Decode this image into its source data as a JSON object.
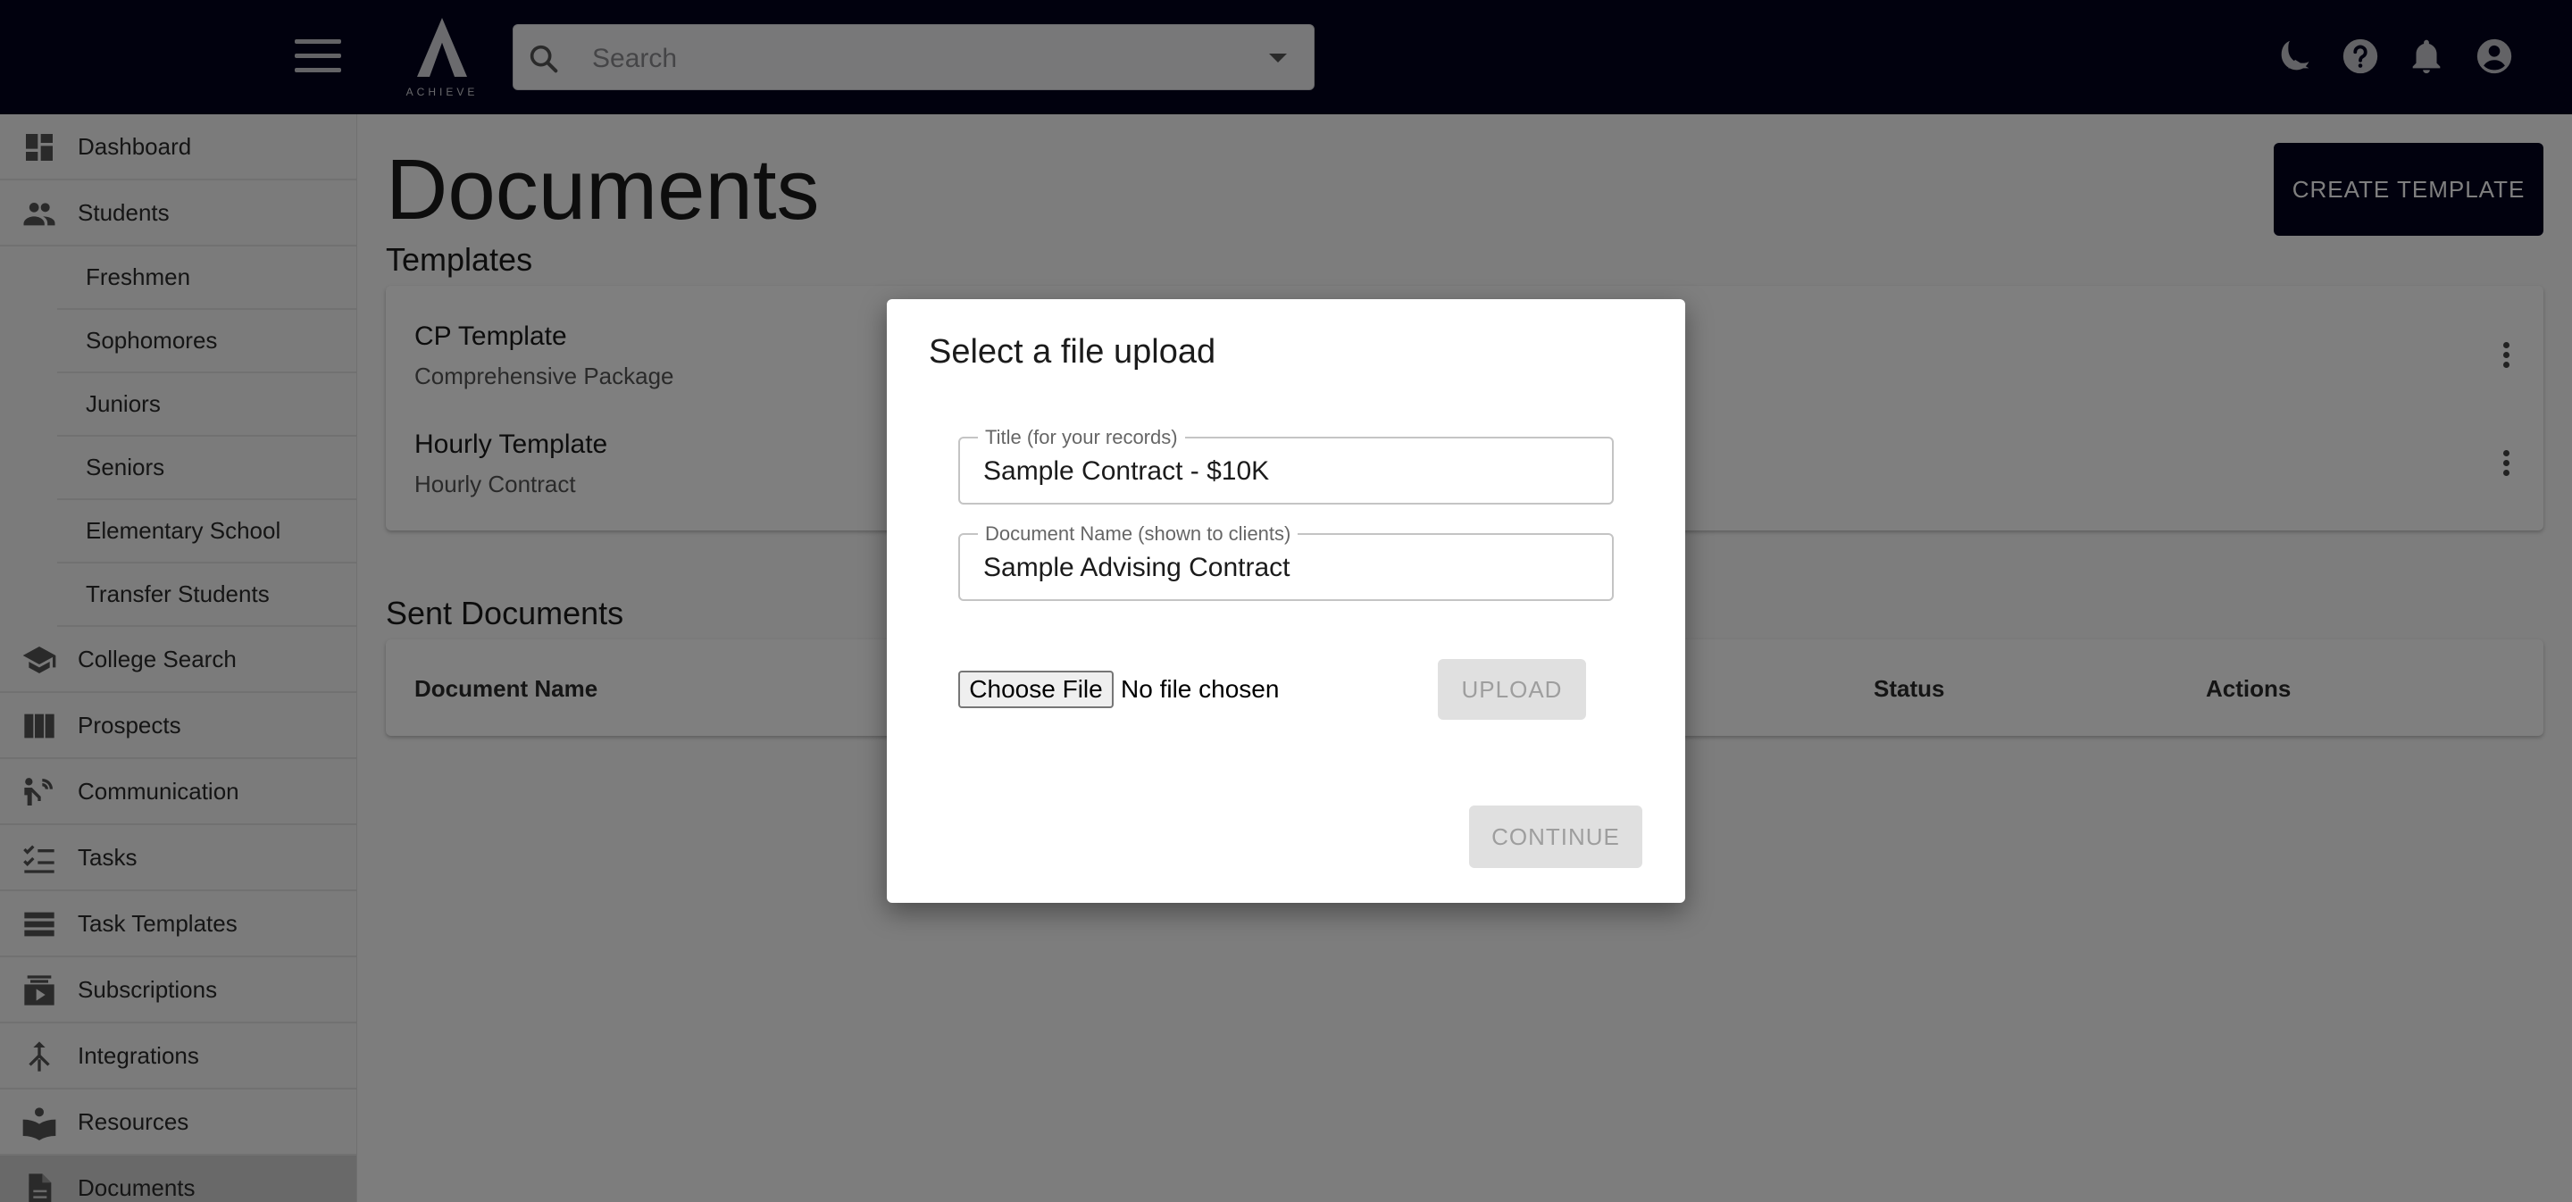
{
  "app": {
    "logo_text": "ACHIEVE"
  },
  "search": {
    "placeholder": "Search"
  },
  "header_icons": [
    "theme-toggle-icon",
    "help-icon",
    "notifications-icon",
    "account-icon"
  ],
  "sidebar": {
    "items": [
      {
        "label": "Dashboard",
        "icon": "dashboard-icon"
      },
      {
        "label": "Students",
        "icon": "people-icon"
      },
      {
        "label": "Freshmen",
        "sub": true
      },
      {
        "label": "Sophomores",
        "sub": true
      },
      {
        "label": "Juniors",
        "sub": true
      },
      {
        "label": "Seniors",
        "sub": true
      },
      {
        "label": "Elementary School",
        "sub": true
      },
      {
        "label": "Transfer Students",
        "sub": true
      },
      {
        "label": "College Search",
        "icon": "school-icon"
      },
      {
        "label": "Prospects",
        "icon": "columns-icon"
      },
      {
        "label": "Communication",
        "icon": "communication-icon"
      },
      {
        "label": "Tasks",
        "icon": "checklist-icon"
      },
      {
        "label": "Task Templates",
        "icon": "list-icon"
      },
      {
        "label": "Subscriptions",
        "icon": "subscriptions-icon"
      },
      {
        "label": "Integrations",
        "icon": "merge-icon"
      },
      {
        "label": "Resources",
        "icon": "book-icon"
      },
      {
        "label": "Documents",
        "icon": "document-icon",
        "active": true
      }
    ]
  },
  "main": {
    "title": "Documents",
    "create_button": "CREATE TEMPLATE",
    "templates_title": "Templates",
    "templates": [
      {
        "title": "CP Template",
        "subtitle": "Comprehensive Package"
      },
      {
        "title": "Hourly Template",
        "subtitle": "Hourly Contract"
      }
    ],
    "sent_title": "Sent Documents",
    "sent_columns": [
      "Document Name",
      "Status",
      "Actions"
    ]
  },
  "modal": {
    "title": "Select a file upload",
    "title_field": {
      "label": "Title (for your records)",
      "value": "Sample Contract - $10K"
    },
    "docname_field": {
      "label": "Document Name (shown to clients)",
      "value": "Sample Advising Contract"
    },
    "choose_file": "Choose File",
    "no_file": "No file chosen",
    "upload": "UPLOAD",
    "continue": "CONTINUE"
  }
}
